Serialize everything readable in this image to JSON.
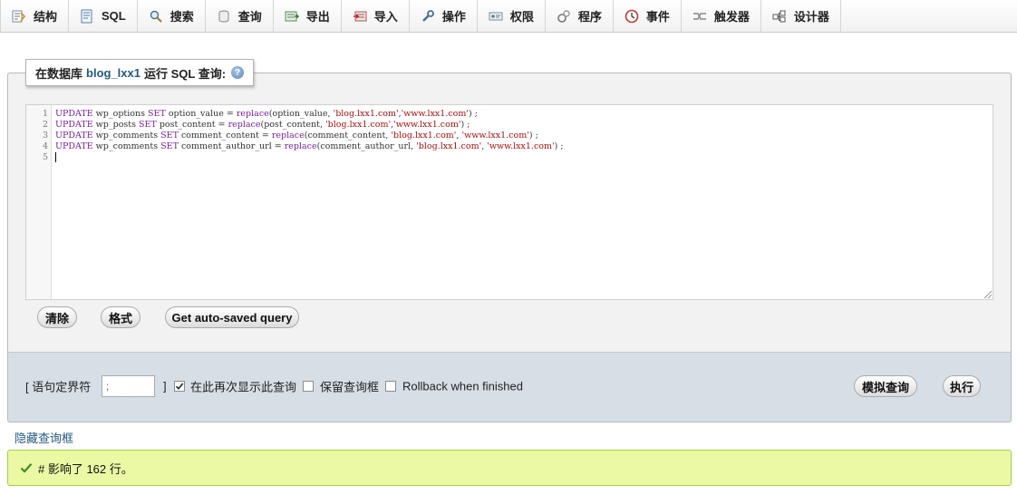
{
  "tabs": [
    {
      "name": "tab-structure",
      "icon": "structure-icon",
      "label": "结构"
    },
    {
      "name": "tab-sql",
      "icon": "sql-icon",
      "label": "SQL"
    },
    {
      "name": "tab-search",
      "icon": "search-icon",
      "label": "搜索"
    },
    {
      "name": "tab-query",
      "icon": "query-icon",
      "label": "查询"
    },
    {
      "name": "tab-export",
      "icon": "export-icon",
      "label": "导出"
    },
    {
      "name": "tab-import",
      "icon": "import-icon",
      "label": "导入"
    },
    {
      "name": "tab-operations",
      "icon": "wrench-icon",
      "label": "操作"
    },
    {
      "name": "tab-privileges",
      "icon": "privileges-icon",
      "label": "权限"
    },
    {
      "name": "tab-routines",
      "icon": "routines-icon",
      "label": "程序"
    },
    {
      "name": "tab-events",
      "icon": "clock-icon",
      "label": "事件"
    },
    {
      "name": "tab-triggers",
      "icon": "triggers-icon",
      "label": "触发器"
    },
    {
      "name": "tab-designer",
      "icon": "designer-icon",
      "label": "设计器"
    }
  ],
  "legend": {
    "prefix": "在数据库",
    "database": "blog_lxx1",
    "suffix": "运行 SQL 查询:"
  },
  "editor": {
    "line_numbers": [
      "1",
      "2",
      "3",
      "4",
      "5"
    ],
    "lines": [
      [
        [
          "kw",
          "UPDATE"
        ],
        [
          "t",
          " wp_options "
        ],
        [
          "kw",
          "SET"
        ],
        [
          "t",
          " option_value = "
        ],
        [
          "fn",
          "replace"
        ],
        [
          "t",
          "(option_value, "
        ],
        [
          "str",
          "'blog.lxx1.com'"
        ],
        [
          "t",
          ","
        ],
        [
          "str",
          "'www.lxx1.com'"
        ],
        [
          "t",
          ") ;"
        ]
      ],
      [
        [
          "kw",
          "UPDATE"
        ],
        [
          "t",
          " wp_posts "
        ],
        [
          "kw",
          "SET"
        ],
        [
          "t",
          " post_content = "
        ],
        [
          "fn",
          "replace"
        ],
        [
          "t",
          "(post_content, "
        ],
        [
          "str",
          "'blog.lxx1.com'"
        ],
        [
          "t",
          ","
        ],
        [
          "str",
          "'www.lxx1.com'"
        ],
        [
          "t",
          ") ;"
        ]
      ],
      [
        [
          "kw",
          "UPDATE"
        ],
        [
          "t",
          " wp_comments "
        ],
        [
          "kw",
          "SET"
        ],
        [
          "t",
          " comment_content = "
        ],
        [
          "fn",
          "replace"
        ],
        [
          "t",
          "(comment_content, "
        ],
        [
          "str",
          "'blog.lxx1.com'"
        ],
        [
          "t",
          ", "
        ],
        [
          "str",
          "'www.lxx1.com'"
        ],
        [
          "t",
          ") ;"
        ]
      ],
      [
        [
          "kw",
          "UPDATE"
        ],
        [
          "t",
          " wp_comments "
        ],
        [
          "kw",
          "SET"
        ],
        [
          "t",
          " comment_author_url = "
        ],
        [
          "fn",
          "replace"
        ],
        [
          "t",
          "(comment_author_url, "
        ],
        [
          "str",
          "'blog.lxx1.com'"
        ],
        [
          "t",
          ", "
        ],
        [
          "str",
          "'www.lxx1.com'"
        ],
        [
          "t",
          ") ;"
        ]
      ],
      []
    ]
  },
  "buttons": {
    "clear": "清除",
    "format": "格式",
    "autosaved": "Get auto-saved query",
    "simulate": "模拟查询",
    "execute": "执行"
  },
  "options": {
    "delimiter_open": "[ 语句定界符",
    "delimiter_value": ";",
    "delimiter_close": "]",
    "show_again_label": "在此再次显示此查询",
    "show_again_checked": true,
    "retain_label": "保留查询框",
    "retain_checked": false,
    "rollback_label": "Rollback when finished",
    "rollback_checked": false
  },
  "hide_link": "隐藏查询框",
  "result": {
    "message": "# 影响了 162 行。"
  },
  "colors": {
    "accent": "#235a81",
    "success_bg": "#ebf8a4",
    "options_bg": "#d6dfe6"
  }
}
